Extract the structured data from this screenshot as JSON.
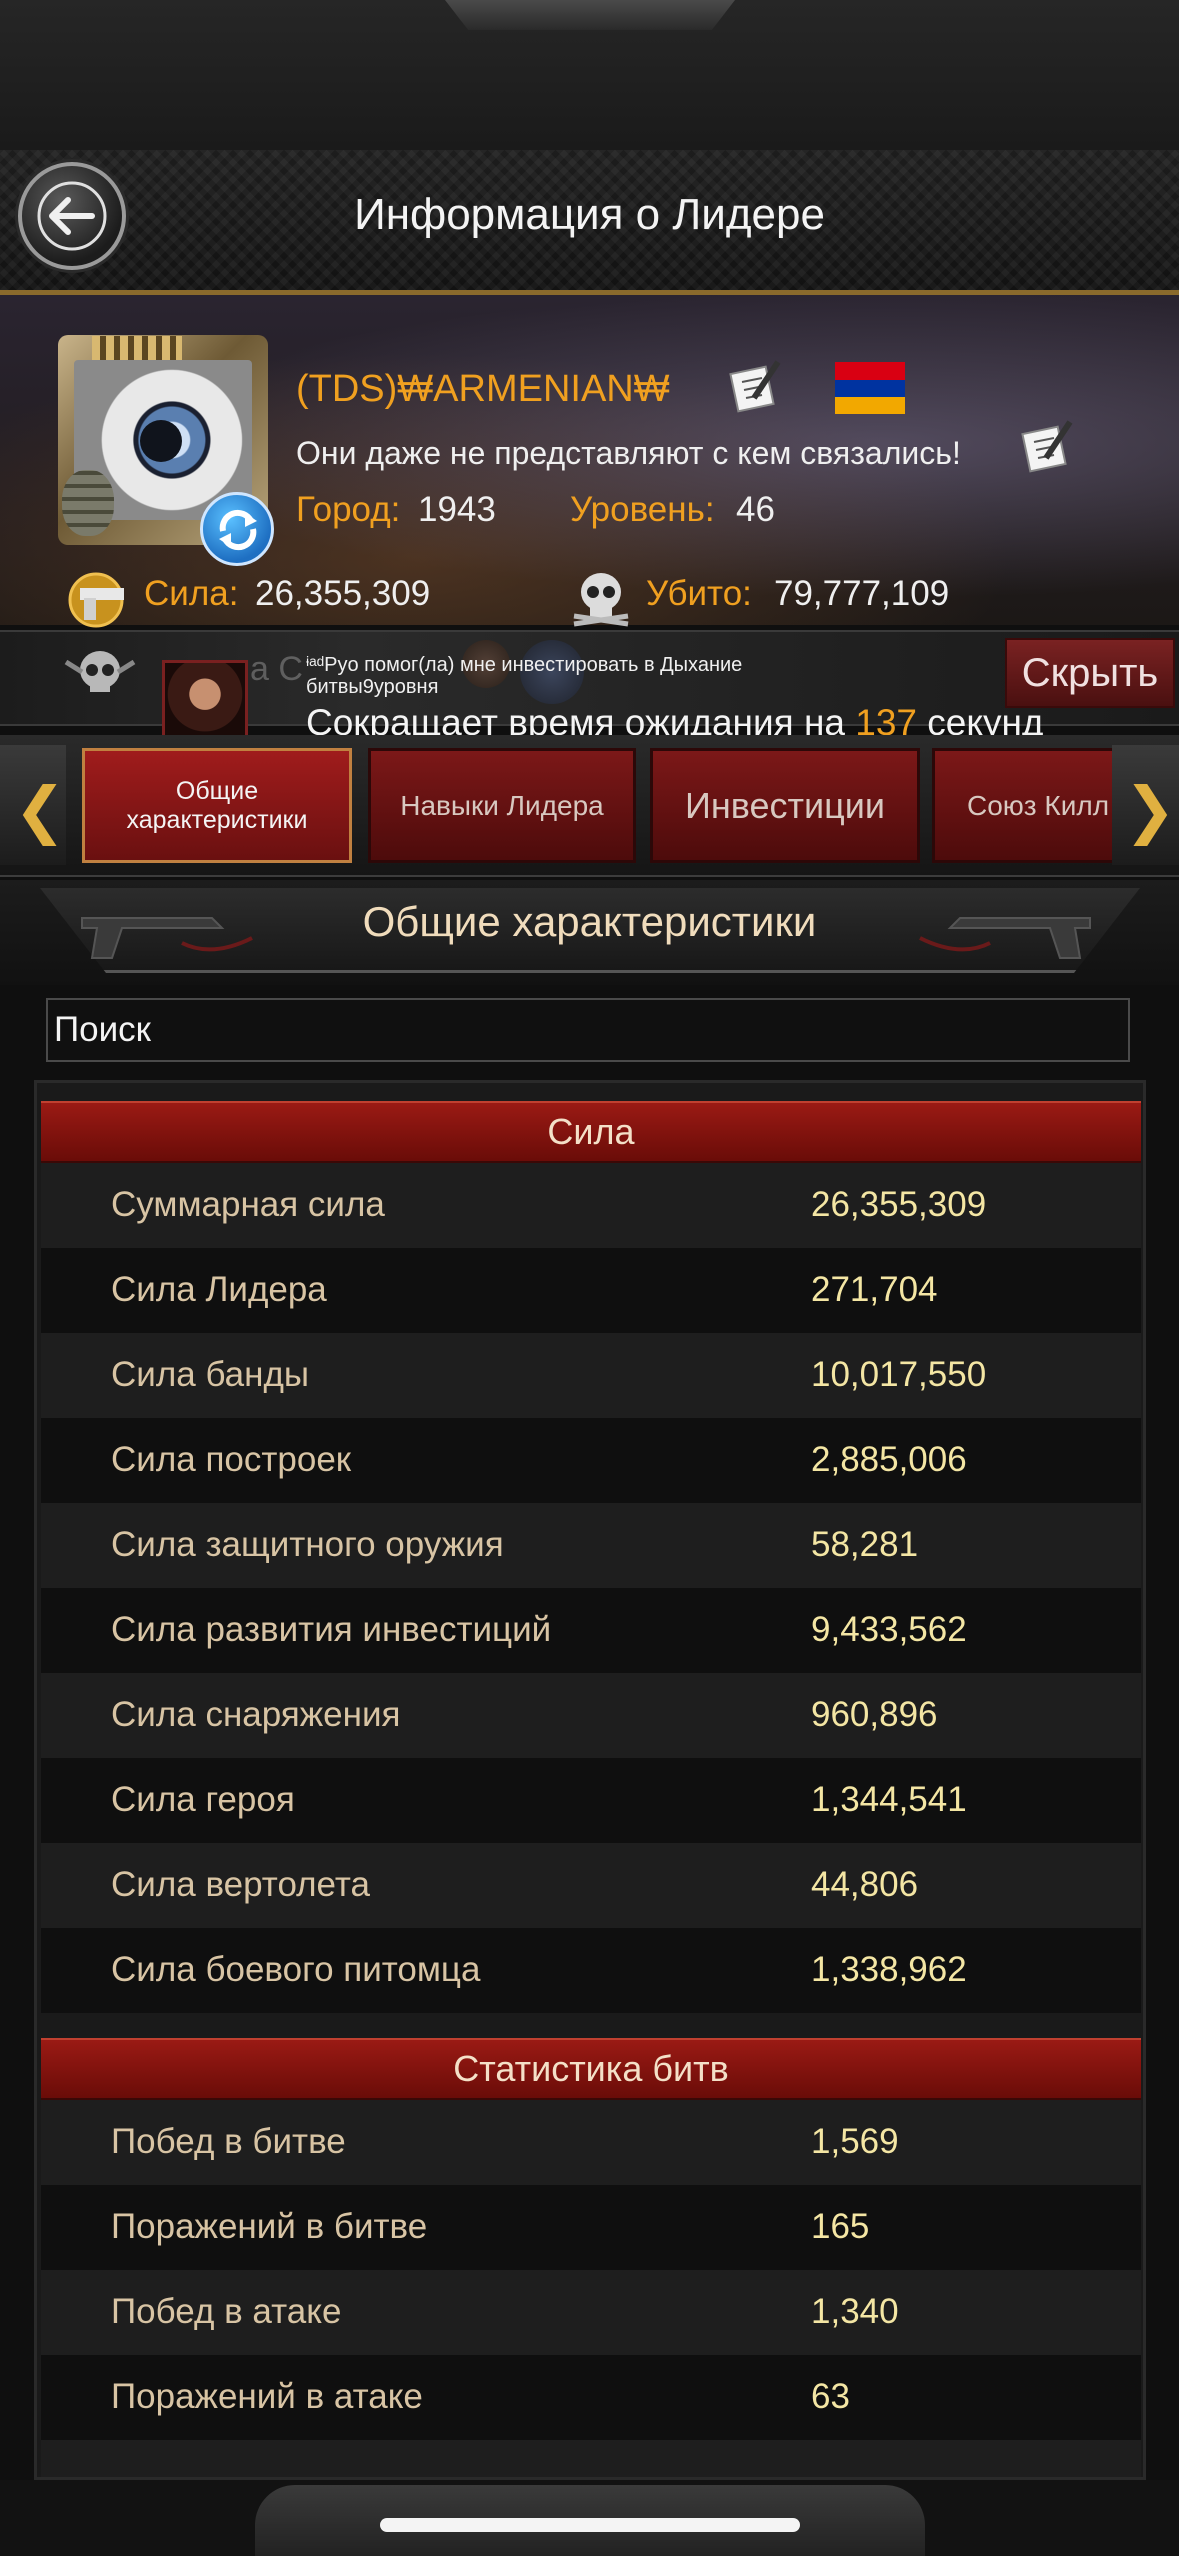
{
  "header": {
    "title": "Информация о Лидере"
  },
  "profile": {
    "name": "(TDS)₩ARMENIAN₩",
    "motto": "Они даже не представляют с кем связались!",
    "city_label": "Город:",
    "city": "1943",
    "level_label": "Уровень:",
    "level": "46",
    "power_label": "Сила:",
    "power": "26,355,309",
    "kills_label": "Убито:",
    "kills": "79,777,109",
    "flag": "armenia-flag",
    "colors": {
      "accent": "#f0a020"
    }
  },
  "notification": {
    "ghost_text": "а С",
    "message": "ᶤᵃᵈPyo помог(ла) мне инвестировать в Дыхание битвы9уровня",
    "reduce_prefix": "Сокращает время ожидания на ",
    "seconds": "137",
    "reduce_suffix": " секунд",
    "hide_label": "Скрыть"
  },
  "tabs": [
    {
      "label": "Общие характеристики",
      "active": true
    },
    {
      "label": "Навыки Лидера",
      "active": false
    },
    {
      "label": "Инвестиции",
      "active": false
    },
    {
      "label": "Союз Килл",
      "active": false
    }
  ],
  "section": {
    "title": "Общие характеристики"
  },
  "search": {
    "placeholder": "Поиск"
  },
  "stats": {
    "power_header": "Сила",
    "power_rows": [
      {
        "name": "Суммарная сила",
        "value": "26,355,309"
      },
      {
        "name": "Сила Лидера",
        "value": "271,704"
      },
      {
        "name": "Сила банды",
        "value": "10,017,550"
      },
      {
        "name": "Сила построек",
        "value": "2,885,006"
      },
      {
        "name": "Сила защитного оружия",
        "value": "58,281"
      },
      {
        "name": "Сила развития инвестиций",
        "value": "9,433,562"
      },
      {
        "name": "Сила снаряжения",
        "value": "960,896"
      },
      {
        "name": "Сила героя",
        "value": "1,344,541"
      },
      {
        "name": "Сила вертолета",
        "value": "44,806"
      },
      {
        "name": "Сила боевого питомца",
        "value": "1,338,962"
      }
    ],
    "battle_header": "Статистика битв",
    "battle_rows": [
      {
        "name": "Побед в битве",
        "value": "1,569"
      },
      {
        "name": "Поражений в битве",
        "value": "165"
      },
      {
        "name": "Побед в атаке",
        "value": "1,340"
      },
      {
        "name": "Поражений в атаке",
        "value": "63"
      }
    ]
  }
}
